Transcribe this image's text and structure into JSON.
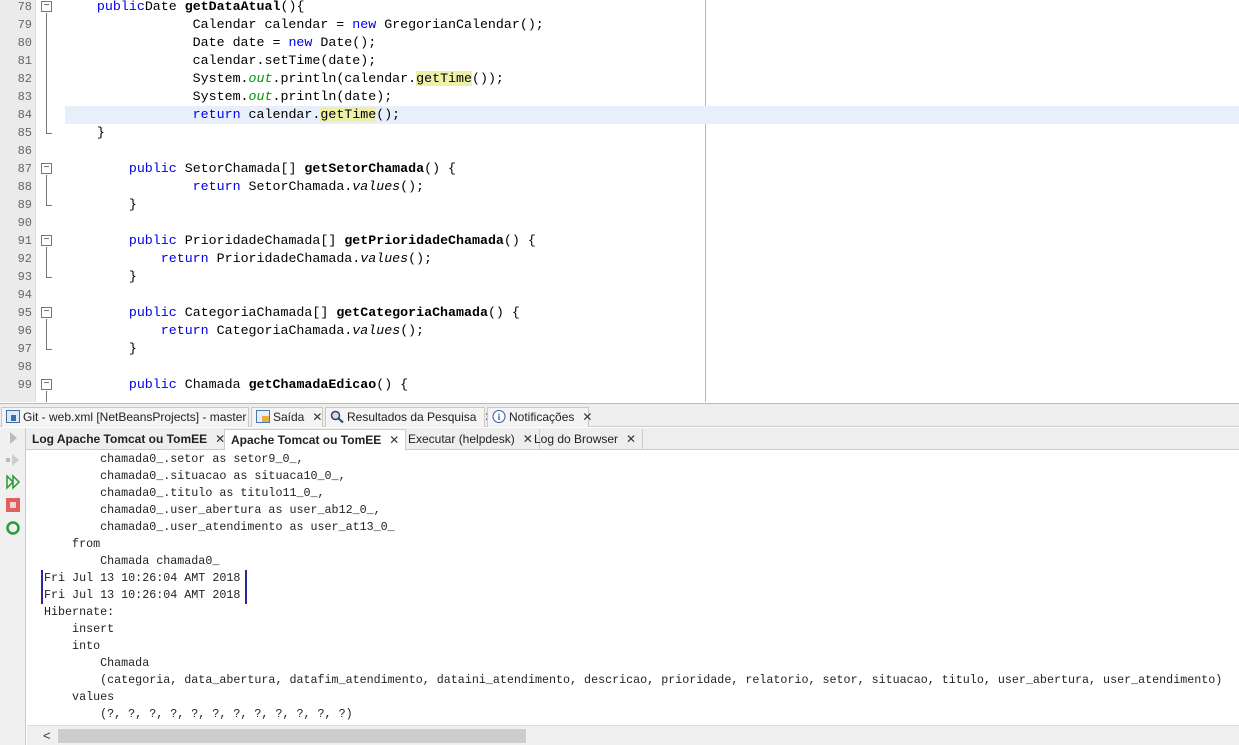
{
  "editor": {
    "first_line": 78,
    "current_line": 84,
    "lines": [
      {
        "n": 78,
        "i": 4,
        "t": [
          [
            "kw",
            "public"
          ],
          [
            "",
            "Date "
          ],
          [
            "b",
            "getDataAtual"
          ],
          [
            "",
            "(){"
          ]
        ],
        "fold": "start"
      },
      {
        "n": 79,
        "i": 16,
        "t": [
          [
            "",
            "Calendar calendar = "
          ],
          [
            "kw",
            "new"
          ],
          [
            "",
            " GregorianCalendar();"
          ]
        ]
      },
      {
        "n": 80,
        "i": 16,
        "t": [
          [
            "",
            "Date date = "
          ],
          [
            "kw",
            "new"
          ],
          [
            "",
            " Date();"
          ]
        ]
      },
      {
        "n": 81,
        "i": 16,
        "t": [
          [
            "",
            "calendar.setTime(date);"
          ]
        ]
      },
      {
        "n": 82,
        "i": 16,
        "t": [
          [
            "",
            "System."
          ],
          [
            "fld",
            "out"
          ],
          [
            "",
            ".println(calendar."
          ],
          [
            "hl",
            "getTime"
          ],
          [
            "",
            "());"
          ]
        ]
      },
      {
        "n": 83,
        "i": 16,
        "t": [
          [
            "",
            "System."
          ],
          [
            "fld",
            "out"
          ],
          [
            "",
            ".println(date);"
          ]
        ]
      },
      {
        "n": 84,
        "i": 16,
        "t": [
          [
            "kw",
            "return"
          ],
          [
            "",
            " calendar."
          ],
          [
            "hl",
            "getTime"
          ],
          [
            "",
            "();"
          ]
        ]
      },
      {
        "n": 85,
        "i": 4,
        "t": [
          [
            "",
            "}"
          ]
        ],
        "fold": "end"
      },
      {
        "n": 86,
        "i": 0,
        "t": []
      },
      {
        "n": 87,
        "i": 8,
        "t": [
          [
            "kw",
            "public"
          ],
          [
            "",
            " SetorChamada[] "
          ],
          [
            "b",
            "getSetorChamada"
          ],
          [
            "",
            "() {"
          ]
        ],
        "fold": "start"
      },
      {
        "n": 88,
        "i": 16,
        "t": [
          [
            "kw",
            "return"
          ],
          [
            "",
            " SetorChamada."
          ],
          [
            "it",
            "values"
          ],
          [
            "",
            "();"
          ]
        ]
      },
      {
        "n": 89,
        "i": 8,
        "t": [
          [
            "",
            "}"
          ]
        ],
        "fold": "end"
      },
      {
        "n": 90,
        "i": 0,
        "t": []
      },
      {
        "n": 91,
        "i": 8,
        "t": [
          [
            "kw",
            "public"
          ],
          [
            "",
            " PrioridadeChamada[] "
          ],
          [
            "b",
            "getPrioridadeChamada"
          ],
          [
            "",
            "() {"
          ]
        ],
        "fold": "start"
      },
      {
        "n": 92,
        "i": 12,
        "t": [
          [
            "kw",
            "return"
          ],
          [
            "",
            " PrioridadeChamada."
          ],
          [
            "it",
            "values"
          ],
          [
            "",
            "();"
          ]
        ]
      },
      {
        "n": 93,
        "i": 8,
        "t": [
          [
            "",
            "}"
          ]
        ],
        "fold": "end"
      },
      {
        "n": 94,
        "i": 0,
        "t": []
      },
      {
        "n": 95,
        "i": 8,
        "t": [
          [
            "kw",
            "public"
          ],
          [
            "",
            " CategoriaChamada[] "
          ],
          [
            "b",
            "getCategoriaChamada"
          ],
          [
            "",
            "() {"
          ]
        ],
        "fold": "start"
      },
      {
        "n": 96,
        "i": 12,
        "t": [
          [
            "kw",
            "return"
          ],
          [
            "",
            " CategoriaChamada."
          ],
          [
            "it",
            "values"
          ],
          [
            "",
            "();"
          ]
        ]
      },
      {
        "n": 97,
        "i": 8,
        "t": [
          [
            "",
            "}"
          ]
        ],
        "fold": "end"
      },
      {
        "n": 98,
        "i": 0,
        "t": []
      },
      {
        "n": 99,
        "i": 8,
        "t": [
          [
            "kw",
            "public"
          ],
          [
            "",
            " Chamada "
          ],
          [
            "b",
            "getChamadaEdicao"
          ],
          [
            "",
            "() {"
          ]
        ],
        "fold": "start"
      }
    ]
  },
  "window_tabs": [
    {
      "label": "Git - web.xml [NetBeansProjects] - master",
      "icon": "git-icon"
    },
    {
      "label": "Saída",
      "icon": "output-icon"
    },
    {
      "label": "Resultados da Pesquisa",
      "icon": "search-icon"
    },
    {
      "label": "Notificações",
      "icon": "info-icon"
    }
  ],
  "output_tabs": [
    {
      "label": "Log Apache Tomcat ou TomEE"
    },
    {
      "label": "Apache Tomcat ou TomEE"
    },
    {
      "label": "Executar (helpdesk)"
    },
    {
      "label": "Log do Browser"
    }
  ],
  "close_glyph": "✕",
  "output_lines": [
    "        chamada0_.setor as setor9_0_,",
    "        chamada0_.situacao as situaca10_0_,",
    "        chamada0_.titulo as titulo11_0_,",
    "        chamada0_.user_abertura as user_ab12_0_,",
    "        chamada0_.user_atendimento as user_at13_0_",
    "    from",
    "        Chamada chamada0_",
    "Fri Jul 13 10:26:04 AMT 2018",
    "Fri Jul 13 10:26:04 AMT 2018",
    "Hibernate:",
    "    insert",
    "    into",
    "        Chamada",
    "        (categoria, data_abertura, datafim_atendimento, dataini_atendimento, descricao, prioridade, relatorio, setor, situacao, titulo, user_abertura, user_atendimento)",
    "    values",
    "        (?, ?, ?, ?, ?, ?, ?, ?, ?, ?, ?, ?)"
  ],
  "scroll_left_glyph": "<",
  "colors": {
    "keyword": "#0000e6",
    "field": "#009900",
    "highlight": "#eef0a8",
    "current_line": "#e9effa"
  }
}
